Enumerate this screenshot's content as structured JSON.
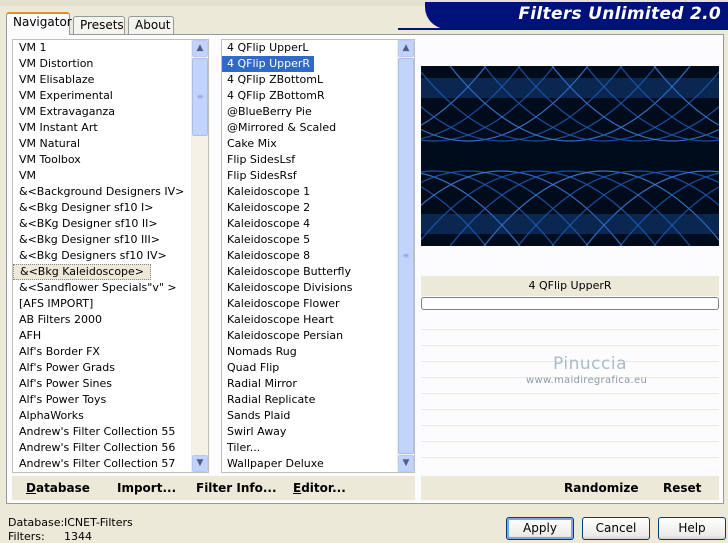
{
  "header": {
    "title": "Filters Unlimited 2.0"
  },
  "tabs": [
    {
      "label": "Navigator"
    },
    {
      "label": "Presets"
    },
    {
      "label": "About"
    }
  ],
  "categories": [
    "VM 1",
    "VM Distortion",
    "VM Elisablaze",
    "VM Experimental",
    "VM Extravaganza",
    "VM Instant Art",
    "VM Natural",
    "VM Toolbox",
    "VM",
    "&<Background Designers IV>",
    "&<Bkg Designer sf10 I>",
    "&<BKg Designer sf10 II>",
    "&<Bkg Designer sf10 III>",
    "&<Bkg Designers sf10 IV>",
    "&<Bkg Kaleidoscope>",
    "&<Sandflower Specials\"v\" >",
    "[AFS IMPORT]",
    "AB Filters 2000",
    "AFH",
    "Alf's Border FX",
    "Alf's Power Grads",
    "Alf's Power Sines",
    "Alf's Power Toys",
    "AlphaWorks",
    "Andrew's Filter Collection 55",
    "Andrew's Filter Collection 56",
    "Andrew's Filter Collection 57"
  ],
  "category_selected_index": 14,
  "filters": [
    "4 QFlip UpperL",
    "4 QFlip UpperR",
    "4 QFlip ZBottomL",
    "4 QFlip ZBottomR",
    "@BlueBerry Pie",
    "@Mirrored & Scaled",
    "Cake Mix",
    "Flip SidesLsf",
    "Flip SidesRsf",
    "Kaleidoscope 1",
    "Kaleidoscope 2",
    "Kaleidoscope 4",
    "Kaleidoscope 5",
    "Kaleidoscope 8",
    "Kaleidoscope Butterfly",
    "Kaleidoscope Divisions",
    "Kaleidoscope Flower",
    "Kaleidoscope Heart",
    "Kaleidoscope Persian",
    "Nomads Rug",
    "Quad Flip",
    "Radial Mirror",
    "Radial Replicate",
    "Sands Plaid",
    "Swirl Away",
    "Tiler...",
    "Wallpaper Deluxe"
  ],
  "filter_selected_index": 1,
  "preview": {
    "filter_name": "4 QFlip UpperR",
    "watermark_name": "Pinuccia",
    "watermark_url": "www.maidiregrafica.eu",
    "colors": {
      "background": "#000b1c",
      "line": "#3f7fd9",
      "glow": "#1e5bb5"
    }
  },
  "left_buttons": {
    "database": "Database",
    "import": "Import...",
    "filter_info": "Filter Info...",
    "editor": "Editor..."
  },
  "right_buttons": {
    "randomize": "Randomize",
    "reset": "Reset"
  },
  "status": {
    "database_label": "Database:",
    "database_value": "ICNET-Filters",
    "filters_label": "Filters:",
    "filters_value": "1344"
  },
  "dialog_buttons": {
    "apply": "Apply",
    "cancel": "Cancel",
    "help": "Help"
  }
}
